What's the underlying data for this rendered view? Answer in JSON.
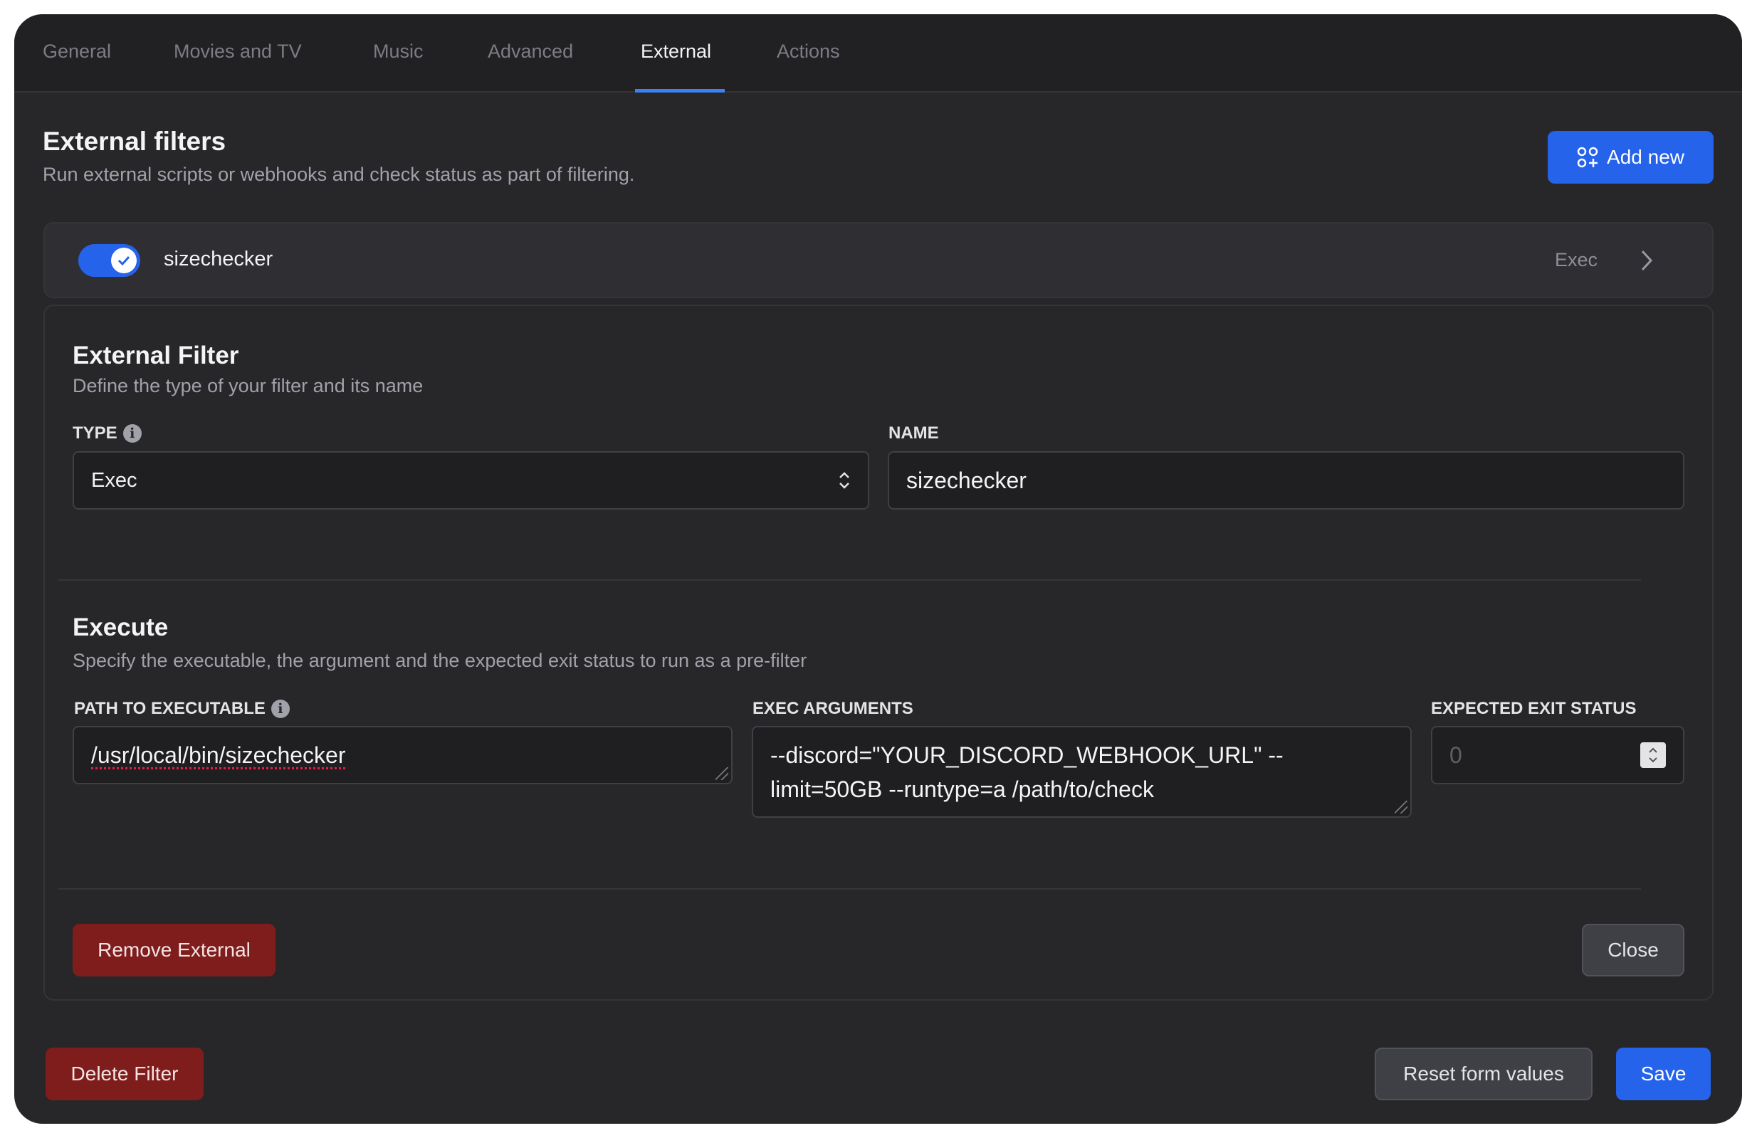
{
  "tabs": [
    {
      "label": "General"
    },
    {
      "label": "Movies and TV"
    },
    {
      "label": "Music"
    },
    {
      "label": "Advanced"
    },
    {
      "label": "External",
      "active": true
    },
    {
      "label": "Actions"
    }
  ],
  "header": {
    "title": "External filters",
    "subtitle": "Run external scripts or webhooks and check status as part of filtering.",
    "add_label": "Add new"
  },
  "filter_row": {
    "name": "sizechecker",
    "type": "Exec",
    "enabled": true
  },
  "form": {
    "title": "External Filter",
    "subtitle": "Define the type of your filter and its name",
    "type_label": "TYPE",
    "type_value": "Exec",
    "name_label": "NAME",
    "name_value": "sizechecker",
    "exec_title": "Execute",
    "exec_subtitle": "Specify the executable, the argument and the expected exit status to run as a pre-filter",
    "path_label": "PATH TO EXECUTABLE",
    "path_value": "/usr/local/bin/sizechecker",
    "args_label": "EXEC ARGUMENTS",
    "args_line1": "--discord=\"YOUR_DISCORD_WEBHOOK_URL\" --",
    "args_line2": "limit=50GB --runtype=a /path/to/check",
    "exit_label": "EXPECTED EXIT STATUS",
    "exit_value": "0",
    "remove_label": "Remove External",
    "close_label": "Close"
  },
  "footer": {
    "delete_label": "Delete Filter",
    "reset_label": "Reset form values",
    "save_label": "Save"
  },
  "colors": {
    "accent": "#2563eb",
    "danger": "#7f1d1d",
    "background": "#27272a"
  }
}
